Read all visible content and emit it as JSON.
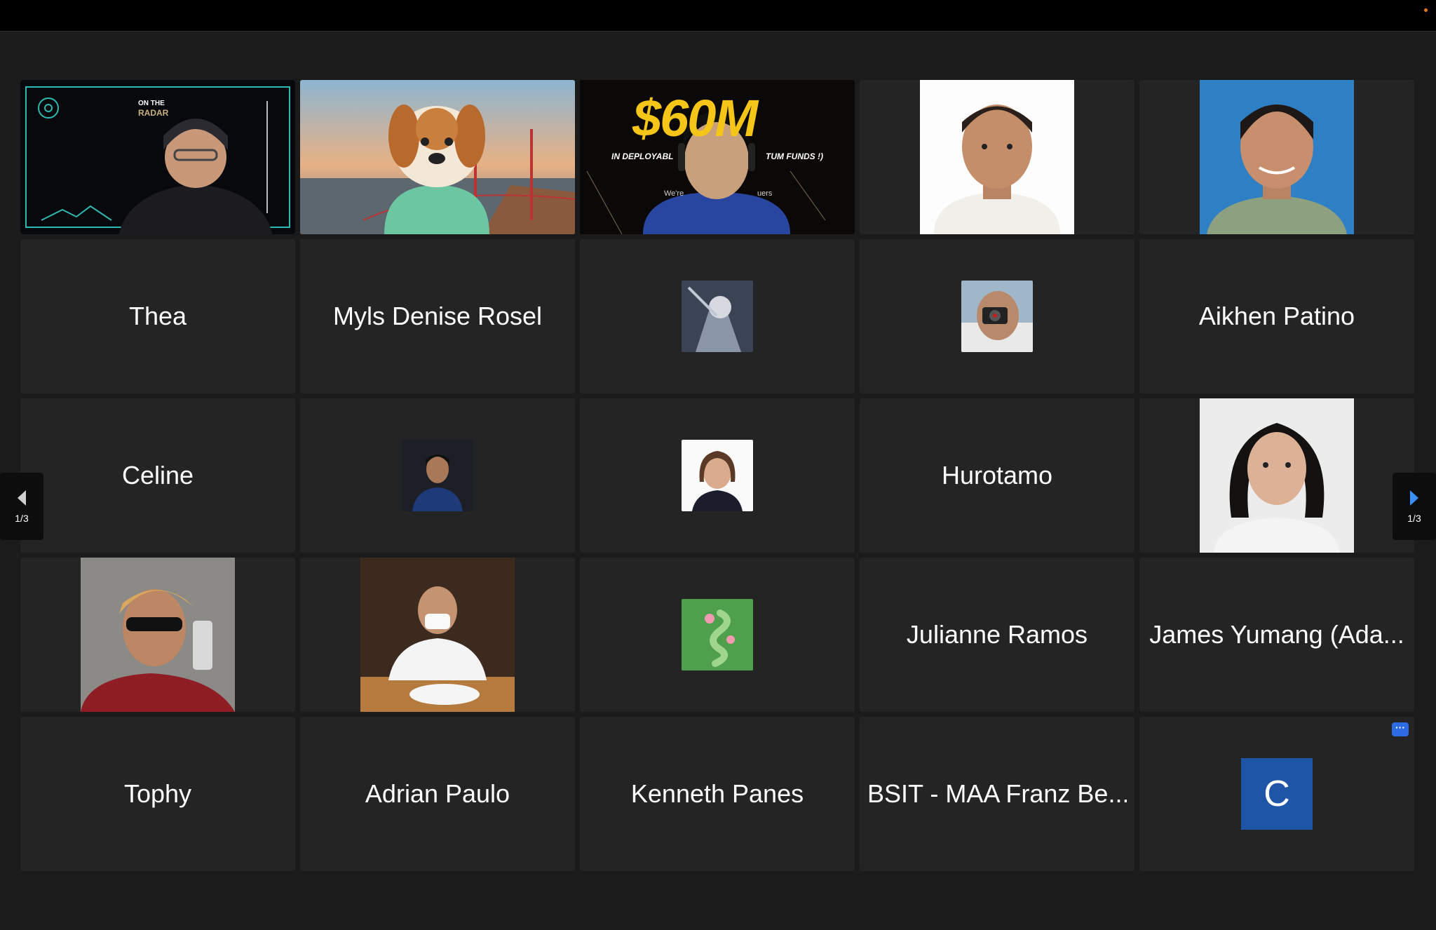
{
  "window": {
    "status_dot_color": "#e07b1a"
  },
  "grid": {
    "tiles": [
      {
        "kind": "video",
        "speaking": true,
        "overlay_top": "ON THE",
        "overlay_bottom": "RADAR"
      },
      {
        "kind": "video",
        "avatar": "dog-avatar"
      },
      {
        "kind": "video",
        "banner_amount": "$60M",
        "banner_left": "IN DEPLOYABL",
        "banner_right": "TUM FUNDS !)",
        "banner_small_left": "We're",
        "banner_small_right": "uers"
      },
      {
        "kind": "photo"
      },
      {
        "kind": "photo"
      },
      {
        "kind": "name",
        "label": "Thea"
      },
      {
        "kind": "name",
        "label": "Myls Denise Rosel"
      },
      {
        "kind": "thumb"
      },
      {
        "kind": "thumb"
      },
      {
        "kind": "name",
        "label": "Aikhen Patino"
      },
      {
        "kind": "name",
        "label": "Celine"
      },
      {
        "kind": "thumb"
      },
      {
        "kind": "thumb"
      },
      {
        "kind": "name",
        "label": "Hurotamo"
      },
      {
        "kind": "photo"
      },
      {
        "kind": "photo"
      },
      {
        "kind": "photo"
      },
      {
        "kind": "thumb"
      },
      {
        "kind": "name",
        "label": "Julianne Ramos"
      },
      {
        "kind": "name",
        "label": "James Yumang (Ada..."
      },
      {
        "kind": "name",
        "label": "Tophy"
      },
      {
        "kind": "name",
        "label": "Adrian Paulo"
      },
      {
        "kind": "name",
        "label": "Kenneth Panes"
      },
      {
        "kind": "name",
        "label": "BSIT - MAA Franz Be..."
      },
      {
        "kind": "letter",
        "letter": "C",
        "badge": "···"
      }
    ]
  },
  "pager": {
    "left": {
      "label": "1/3",
      "icon": "chevron-left-icon"
    },
    "right": {
      "label": "1/3",
      "icon": "chevron-right-icon"
    }
  },
  "colors": {
    "speaking_border": "#2fd06c",
    "tile_bg": "#242424",
    "accent": "#2d6be4"
  }
}
